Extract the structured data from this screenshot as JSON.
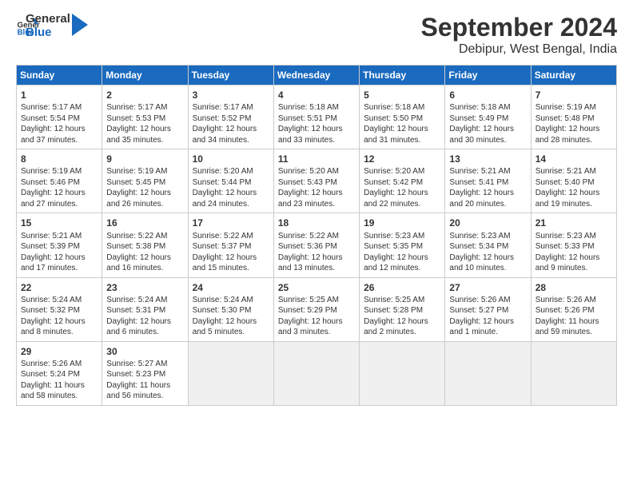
{
  "header": {
    "logo_general": "General",
    "logo_blue": "Blue",
    "title": "September 2024",
    "subtitle": "Debipur, West Bengal, India"
  },
  "calendar": {
    "days_of_week": [
      "Sunday",
      "Monday",
      "Tuesday",
      "Wednesday",
      "Thursday",
      "Friday",
      "Saturday"
    ],
    "weeks": [
      [
        {
          "day": "1",
          "sunrise": "5:17 AM",
          "sunset": "5:54 PM",
          "daylight": "12 hours and 37 minutes."
        },
        {
          "day": "2",
          "sunrise": "5:17 AM",
          "sunset": "5:53 PM",
          "daylight": "12 hours and 35 minutes."
        },
        {
          "day": "3",
          "sunrise": "5:17 AM",
          "sunset": "5:52 PM",
          "daylight": "12 hours and 34 minutes."
        },
        {
          "day": "4",
          "sunrise": "5:18 AM",
          "sunset": "5:51 PM",
          "daylight": "12 hours and 33 minutes."
        },
        {
          "day": "5",
          "sunrise": "5:18 AM",
          "sunset": "5:50 PM",
          "daylight": "12 hours and 31 minutes."
        },
        {
          "day": "6",
          "sunrise": "5:18 AM",
          "sunset": "5:49 PM",
          "daylight": "12 hours and 30 minutes."
        },
        {
          "day": "7",
          "sunrise": "5:19 AM",
          "sunset": "5:48 PM",
          "daylight": "12 hours and 28 minutes."
        }
      ],
      [
        {
          "day": "8",
          "sunrise": "5:19 AM",
          "sunset": "5:46 PM",
          "daylight": "12 hours and 27 minutes."
        },
        {
          "day": "9",
          "sunrise": "5:19 AM",
          "sunset": "5:45 PM",
          "daylight": "12 hours and 26 minutes."
        },
        {
          "day": "10",
          "sunrise": "5:20 AM",
          "sunset": "5:44 PM",
          "daylight": "12 hours and 24 minutes."
        },
        {
          "day": "11",
          "sunrise": "5:20 AM",
          "sunset": "5:43 PM",
          "daylight": "12 hours and 23 minutes."
        },
        {
          "day": "12",
          "sunrise": "5:20 AM",
          "sunset": "5:42 PM",
          "daylight": "12 hours and 22 minutes."
        },
        {
          "day": "13",
          "sunrise": "5:21 AM",
          "sunset": "5:41 PM",
          "daylight": "12 hours and 20 minutes."
        },
        {
          "day": "14",
          "sunrise": "5:21 AM",
          "sunset": "5:40 PM",
          "daylight": "12 hours and 19 minutes."
        }
      ],
      [
        {
          "day": "15",
          "sunrise": "5:21 AM",
          "sunset": "5:39 PM",
          "daylight": "12 hours and 17 minutes."
        },
        {
          "day": "16",
          "sunrise": "5:22 AM",
          "sunset": "5:38 PM",
          "daylight": "12 hours and 16 minutes."
        },
        {
          "day": "17",
          "sunrise": "5:22 AM",
          "sunset": "5:37 PM",
          "daylight": "12 hours and 15 minutes."
        },
        {
          "day": "18",
          "sunrise": "5:22 AM",
          "sunset": "5:36 PM",
          "daylight": "12 hours and 13 minutes."
        },
        {
          "day": "19",
          "sunrise": "5:23 AM",
          "sunset": "5:35 PM",
          "daylight": "12 hours and 12 minutes."
        },
        {
          "day": "20",
          "sunrise": "5:23 AM",
          "sunset": "5:34 PM",
          "daylight": "12 hours and 10 minutes."
        },
        {
          "day": "21",
          "sunrise": "5:23 AM",
          "sunset": "5:33 PM",
          "daylight": "12 hours and 9 minutes."
        }
      ],
      [
        {
          "day": "22",
          "sunrise": "5:24 AM",
          "sunset": "5:32 PM",
          "daylight": "12 hours and 8 minutes."
        },
        {
          "day": "23",
          "sunrise": "5:24 AM",
          "sunset": "5:31 PM",
          "daylight": "12 hours and 6 minutes."
        },
        {
          "day": "24",
          "sunrise": "5:24 AM",
          "sunset": "5:30 PM",
          "daylight": "12 hours and 5 minutes."
        },
        {
          "day": "25",
          "sunrise": "5:25 AM",
          "sunset": "5:29 PM",
          "daylight": "12 hours and 3 minutes."
        },
        {
          "day": "26",
          "sunrise": "5:25 AM",
          "sunset": "5:28 PM",
          "daylight": "12 hours and 2 minutes."
        },
        {
          "day": "27",
          "sunrise": "5:26 AM",
          "sunset": "5:27 PM",
          "daylight": "12 hours and 1 minute."
        },
        {
          "day": "28",
          "sunrise": "5:26 AM",
          "sunset": "5:26 PM",
          "daylight": "11 hours and 59 minutes."
        }
      ],
      [
        {
          "day": "29",
          "sunrise": "5:26 AM",
          "sunset": "5:24 PM",
          "daylight": "11 hours and 58 minutes."
        },
        {
          "day": "30",
          "sunrise": "5:27 AM",
          "sunset": "5:23 PM",
          "daylight": "11 hours and 56 minutes."
        },
        {
          "day": "",
          "sunrise": "",
          "sunset": "",
          "daylight": ""
        },
        {
          "day": "",
          "sunrise": "",
          "sunset": "",
          "daylight": ""
        },
        {
          "day": "",
          "sunrise": "",
          "sunset": "",
          "daylight": ""
        },
        {
          "day": "",
          "sunrise": "",
          "sunset": "",
          "daylight": ""
        },
        {
          "day": "",
          "sunrise": "",
          "sunset": "",
          "daylight": ""
        }
      ]
    ]
  }
}
